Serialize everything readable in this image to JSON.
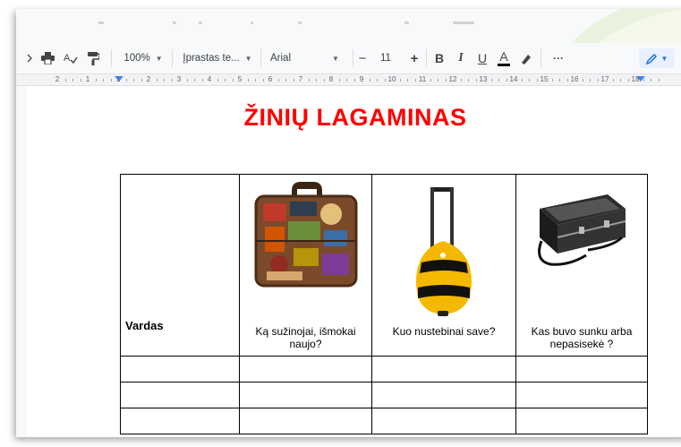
{
  "toolbar": {
    "zoom": "100%",
    "style": "Įprastas te...",
    "font": "Arial",
    "font_size": "11",
    "minus": "−",
    "plus": "+",
    "bold": "B",
    "italic": "I",
    "underline": "U",
    "text_color": "A",
    "more": "···"
  },
  "ruler": {
    "labels": [
      "2",
      "1",
      "1",
      "2",
      "3",
      "4",
      "5",
      "6",
      "7",
      "8",
      "9",
      "10",
      "11",
      "12",
      "13",
      "14",
      "15",
      "16",
      "17",
      "18"
    ]
  },
  "document": {
    "title": "ŽINIŲ LAGAMINAS",
    "table": {
      "headers": [
        "Vardas",
        "Ką sužinojai, išmokai naujo?",
        "Kuo nustebinai save?",
        "Kas buvo sunku arba nepasisekė ?"
      ],
      "header_images": [
        "vintage-suitcase",
        "yellow-rolling-luggage",
        "black-aluminum-case"
      ],
      "empty_rows": 3
    }
  },
  "colors": {
    "title": "#ff0000",
    "ruler_marker": "#4285f4",
    "edit_mode_bg": "#e8f0fe"
  }
}
